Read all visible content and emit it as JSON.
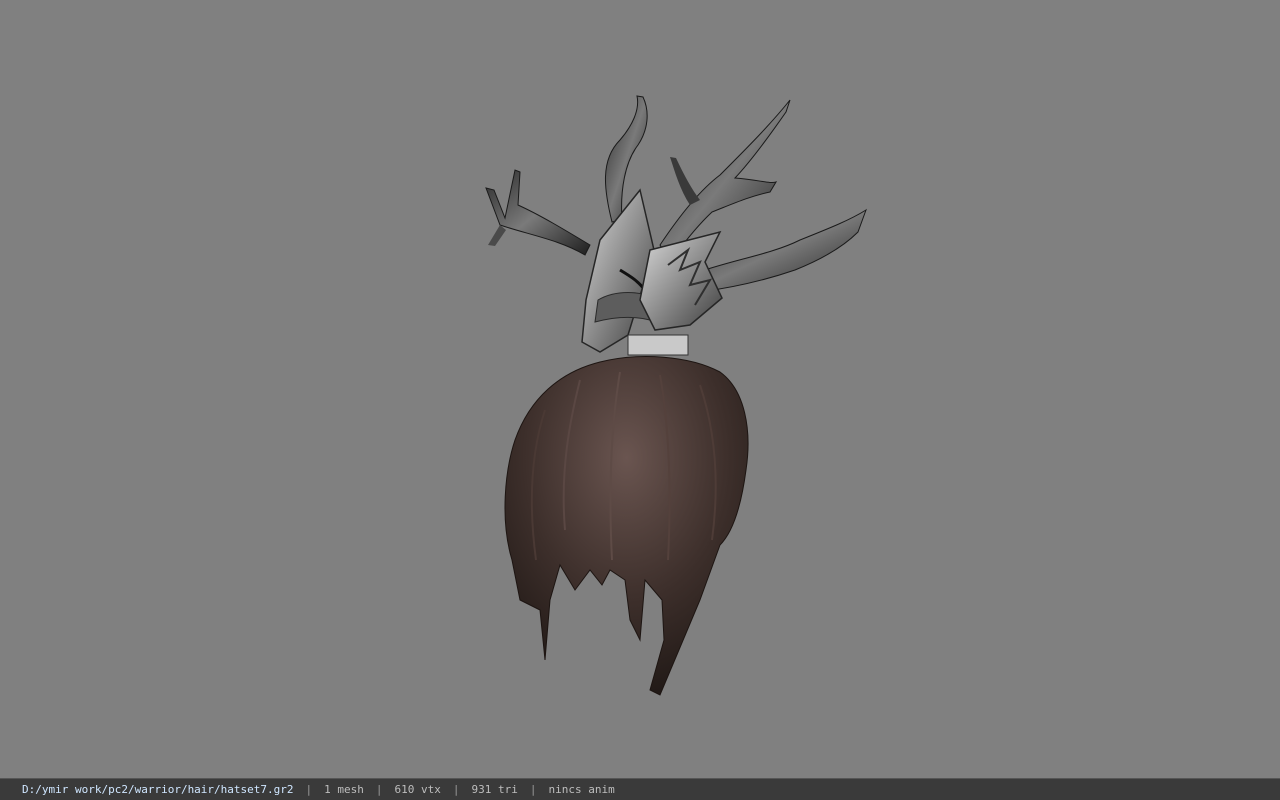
{
  "status_bar": {
    "file_path": "D:/ymir work/pc2/warrior/hair/hatset7.gr2",
    "separator": "|",
    "mesh_count": "1 mesh",
    "vertex_count": "610 vtx",
    "triangle_count": "931 tri",
    "anim_status": "nincs anim"
  },
  "viewport": {
    "background_color": "#808080",
    "model_subject": "hat-with-hair-model"
  }
}
